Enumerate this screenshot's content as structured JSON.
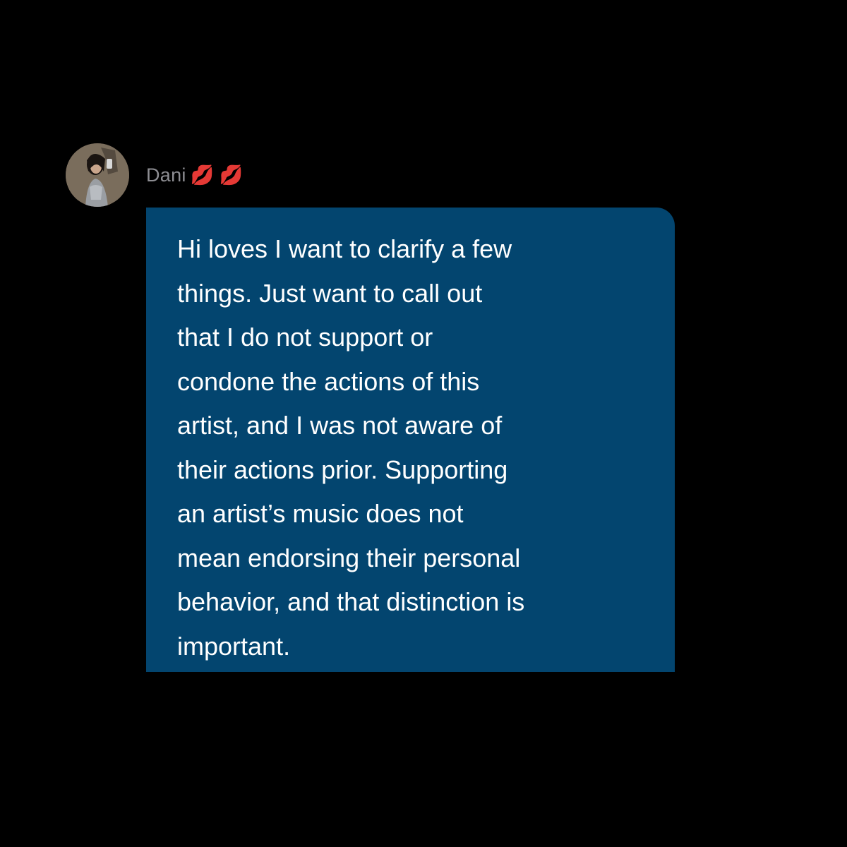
{
  "chat": {
    "sender": {
      "name": "Dani",
      "emoji": "💋 💋"
    },
    "message": {
      "lines": [
        "Hi loves I want to clarify a few",
        "things. Just want to call out",
        "that I do not support or",
        "condone the actions of this",
        "artist, and I was not aware of",
        "their actions prior. Supporting",
        "an artist’s music does not",
        "mean endorsing their personal",
        "behavior, and that distinction is",
        "important."
      ]
    }
  },
  "colors": {
    "background": "#000000",
    "bubble": "#03456f",
    "message_text": "#ffffff",
    "sender_name": "#8e8e93"
  }
}
